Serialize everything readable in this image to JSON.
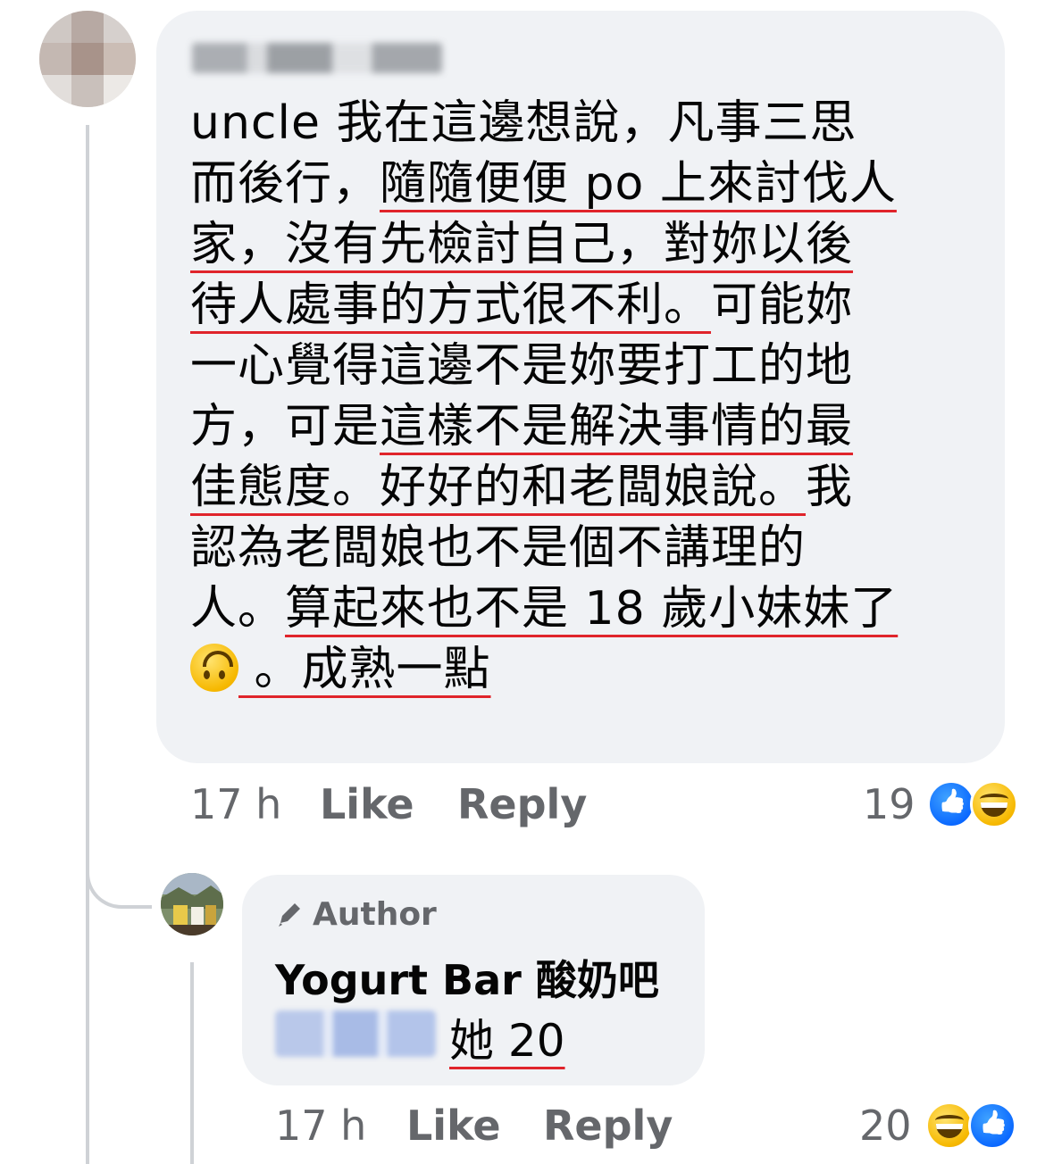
{
  "comment": {
    "author_name": "",
    "lines": [
      [
        {
          "t": "uncle 我在這邊想說，凡事三思",
          "u": false
        }
      ],
      [
        {
          "t": "而後行，",
          "u": false
        },
        {
          "t": "隨隨便便 po 上來討伐人",
          "u": true
        }
      ],
      [
        {
          "t": "家，沒有先檢討自己，對妳以後",
          "u": true
        }
      ],
      [
        {
          "t": "待人處事的方式很不利。",
          "u": true
        },
        {
          "t": "可能妳",
          "u": false
        }
      ],
      [
        {
          "t": "一心覺得這邊不是妳要打工的地",
          "u": false
        }
      ],
      [
        {
          "t": "方，可是",
          "u": false
        },
        {
          "t": "這樣不是解決事情的最",
          "u": true
        }
      ],
      [
        {
          "t": "佳態度。好好的和老闆娘說。",
          "u": true
        },
        {
          "t": "我",
          "u": false
        }
      ],
      [
        {
          "t": "認為老闆娘也不是個不講理的",
          "u": false
        }
      ],
      [
        {
          "t": "人。",
          "u": false
        },
        {
          "t": "算起來也不是 18 歲小妹妹了",
          "u": true
        }
      ],
      [
        {
          "t": "",
          "u": false,
          "emoji": "upside-down-face"
        },
        {
          "t": " 。成熟一點",
          "u": true
        }
      ]
    ],
    "time": "17 h",
    "like_label": "Like",
    "reply_label": "Reply",
    "reaction_count": "19",
    "reactions": [
      "like-icon",
      "haha-icon"
    ]
  },
  "reply": {
    "badge_label": "Author",
    "author_name": "Yogurt Bar 酸奶吧",
    "text": "她 20",
    "time": "17 h",
    "like_label": "Like",
    "reply_label": "Reply",
    "reaction_count": "20",
    "reactions": [
      "haha-icon",
      "like-icon"
    ]
  },
  "colors": {
    "bubble": "#f0f2f5",
    "meta_text": "#65676b",
    "underline": "#e0242b",
    "like_blue": "#0866ff"
  }
}
